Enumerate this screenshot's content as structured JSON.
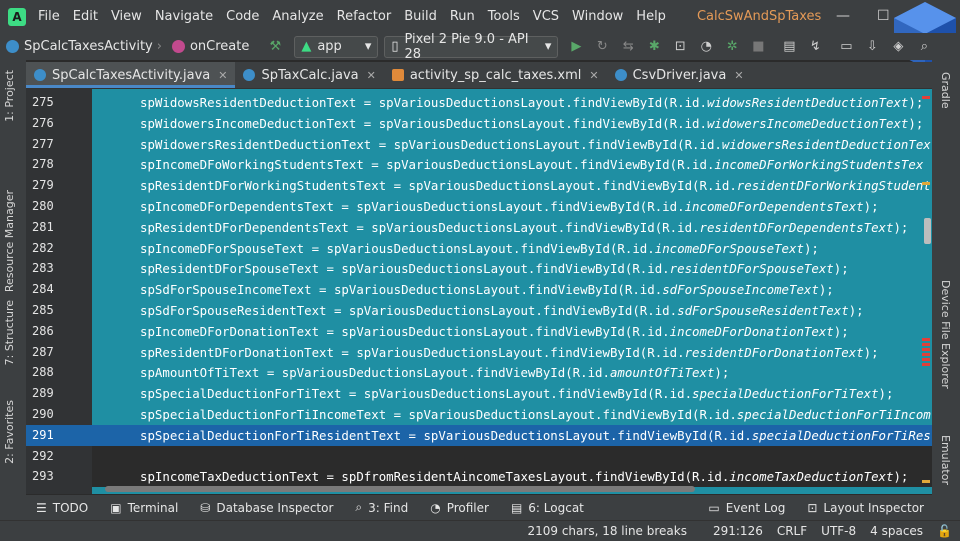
{
  "menubar": {
    "items": [
      "File",
      "Edit",
      "View",
      "Navigate",
      "Code",
      "Analyze",
      "Refactor",
      "Build",
      "Run",
      "Tools",
      "VCS",
      "Window",
      "Help"
    ],
    "project_title": "CalcSwAndSpTaxes"
  },
  "toolbar": {
    "breadcrumb_class": "SpCalcTaxesActivity",
    "breadcrumb_method": "onCreate",
    "run_config": "app",
    "device": "Pixel 2 Pie 9.0 - API 28"
  },
  "tabs": [
    {
      "label": "SpCalcTaxesActivity.java",
      "active": true
    },
    {
      "label": "SpTaxCalc.java",
      "active": false
    },
    {
      "label": "activity_sp_calc_taxes.xml",
      "active": false
    },
    {
      "label": "CsvDriver.java",
      "active": false
    }
  ],
  "left_tools": [
    "1: Project",
    "Resource Manager",
    "7: Structure",
    "2: Favorites"
  ],
  "right_tools": [
    "Gradle",
    "Device File Explorer",
    "Emulator"
  ],
  "code_lines": [
    {
      "num": "275",
      "text": "spWidowsResidentDeductionText = spVariousDeductionsLayout.findViewById(R.id.",
      "id": "widowsResidentDeductionText",
      "tail": ");"
    },
    {
      "num": "276",
      "text": "spWidowersIncomeDeductionText = spVariousDeductionsLayout.findViewById(R.id.",
      "id": "widowersIncomeDeductionText",
      "tail": ");"
    },
    {
      "num": "277",
      "text": "spWidowersResidentDeductionText = spVariousDeductionsLayout.findViewById(R.id.",
      "id": "widowersResidentDeductionTex",
      "tail": ""
    },
    {
      "num": "278",
      "text": "spIncomeDFoWorkingStudentsText = spVariousDeductionsLayout.findViewById(R.id.",
      "id": "incomeDForWorkingStudentsTex",
      "tail": ""
    },
    {
      "num": "279",
      "text": "spResidentDForWorkingStudentsText = spVariousDeductionsLayout.findViewById(R.id.",
      "id": "residentDForWorkingStudent",
      "tail": ""
    },
    {
      "num": "280",
      "text": "spIncomeDForDependentsText = spVariousDeductionsLayout.findViewById(R.id.",
      "id": "incomeDForDependentsText",
      "tail": ");"
    },
    {
      "num": "281",
      "text": "spResidentDForDependentsText = spVariousDeductionsLayout.findViewById(R.id.",
      "id": "residentDForDependentsText",
      "tail": ");"
    },
    {
      "num": "282",
      "text": "spIncomeDForSpouseText = spVariousDeductionsLayout.findViewById(R.id.",
      "id": "incomeDForSpouseText",
      "tail": ");"
    },
    {
      "num": "283",
      "text": "spResidentDForSpouseText = spVariousDeductionsLayout.findViewById(R.id.",
      "id": "residentDForSpouseText",
      "tail": ");"
    },
    {
      "num": "284",
      "text": "spSdForSpouseIncomeText = spVariousDeductionsLayout.findViewById(R.id.",
      "id": "sdForSpouseIncomeText",
      "tail": ");"
    },
    {
      "num": "285",
      "text": "spSdForSpouseResidentText = spVariousDeductionsLayout.findViewById(R.id.",
      "id": "sdForSpouseResidentText",
      "tail": ");"
    },
    {
      "num": "286",
      "text": "spIncomeDForDonationText = spVariousDeductionsLayout.findViewById(R.id.",
      "id": "incomeDForDonationText",
      "tail": ");"
    },
    {
      "num": "287",
      "text": "spResidentDForDonationText = spVariousDeductionsLayout.findViewById(R.id.",
      "id": "residentDForDonationText",
      "tail": ");"
    },
    {
      "num": "288",
      "text": "spAmountOfTiText = spVariousDeductionsLayout.findViewById(R.id.",
      "id": "amountOfTiText",
      "tail": ");"
    },
    {
      "num": "289",
      "text": "spSpecialDeductionForTiText = spVariousDeductionsLayout.findViewById(R.id.",
      "id": "specialDeductionForTiText",
      "tail": ");"
    },
    {
      "num": "290",
      "text": "spSpecialDeductionForTiIncomeText = spVariousDeductionsLayout.findViewById(R.id.",
      "id": "specialDeductionForTiIncom",
      "tail": ""
    },
    {
      "num": "291",
      "text": "spSpecialDeductionForTiResidentText = spVariousDeductionsLayout.findViewById(R.id.",
      "id": "specialDeductionForTiRes",
      "tail": ""
    },
    {
      "num": "292",
      "text": "",
      "id": "",
      "tail": ""
    },
    {
      "num": "293",
      "text": "spIncomeTaxDeductionText = spDfromResidentAincomeTaxesLayout.findViewById(R.id.",
      "id": "incomeTaxDeductionText",
      "tail": ");"
    }
  ],
  "bottom_tools": [
    "TODO",
    "Terminal",
    "Database Inspector",
    "3: Find",
    "Profiler",
    "6: Logcat",
    "Event Log",
    "Layout Inspector"
  ],
  "status": {
    "chars": "2109 chars, 18 line breaks",
    "position": "291:126",
    "line_sep": "CRLF",
    "encoding": "UTF-8",
    "indent": "4 spaces"
  },
  "colors": {
    "selection": "#1f8fa3",
    "current_line": "#1c64a8",
    "project_title": "#e59a57"
  }
}
